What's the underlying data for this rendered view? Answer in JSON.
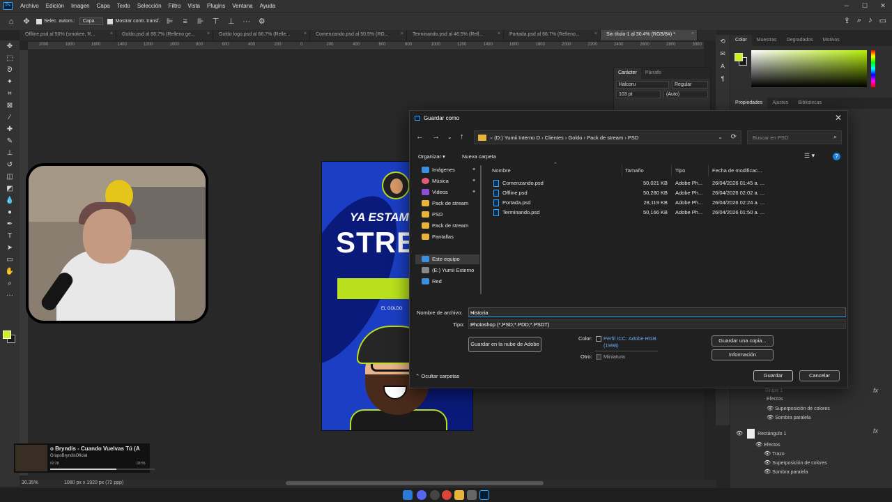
{
  "menubar": {
    "app_logo": "Ps",
    "items": [
      "Archivo",
      "Edición",
      "Imagen",
      "Capa",
      "Texto",
      "Selección",
      "Filtro",
      "Vista",
      "Plugins",
      "Ventana",
      "Ayuda"
    ]
  },
  "optbar": {
    "auto_select_label": "Selec. autom.:",
    "auto_select_target": "Capa",
    "show_transform_label": "Mostrar contr. transf."
  },
  "tabs": [
    {
      "label": "Offline.psd al 50% (smokee, R...",
      "active": false
    },
    {
      "label": "Goldo.psd al 66.7% (Relleno ge...",
      "active": false
    },
    {
      "label": "Goldo logo.psd al 66.7% (Relle...",
      "active": false
    },
    {
      "label": "Comenzando.psd al 50.5% (RG...",
      "active": false
    },
    {
      "label": "Terminando.psd al 46.5% (Rell...",
      "active": false
    },
    {
      "label": "Portada.psd al 66.7% (Relleno...",
      "active": false
    },
    {
      "label": "Sin título-1 al 30.4% (RGB/8#) *",
      "active": true
    }
  ],
  "ruler_labels": [
    "2000",
    "1800",
    "1600",
    "1400",
    "1200",
    "1000",
    "800",
    "600",
    "400",
    "200",
    "0",
    "200",
    "400",
    "600",
    "800",
    "1000",
    "1200",
    "1400",
    "1600",
    "1800",
    "2000",
    "2200",
    "2400",
    "2600",
    "2800",
    "3000"
  ],
  "document": {
    "line1": "YA ESTAM",
    "line2": "STRE",
    "tag": "EL GOLDO"
  },
  "mini_player": {
    "title": "o Bryndis - Cuando Vuelvas Tú (A",
    "artist": "GrupoBryndisOficial",
    "time_elapsed": "02:28",
    "time_total": "03:55",
    "progress": 0.63
  },
  "status_bar": {
    "zoom": "30.35%",
    "doc_info": "1080 px x 1920 px (72 ppp)"
  },
  "color_panel": {
    "tabs": [
      "Color",
      "Muestras",
      "Degradados",
      "Motivos"
    ],
    "foreground": "#cff01a",
    "background": "#1a1a1a"
  },
  "properties_panel": {
    "tabs": [
      "Propiedades",
      "Ajustes",
      "Bibliotecas"
    ]
  },
  "character_panel": {
    "tabs": [
      "Carácter",
      "Párrafo"
    ],
    "font_family": "Halcoru",
    "font_style": "Regular",
    "font_size": "103 pt",
    "leading": "(Auto)"
  },
  "layers": [
    {
      "label": "Grupo 1",
      "fx": true
    },
    {
      "label": "Efectos"
    },
    {
      "label": "Superposición de colores"
    },
    {
      "label": "Sombra paralela"
    },
    {
      "label": "Rectángulo 1",
      "fx": true
    },
    {
      "label": "Efectos"
    },
    {
      "label": "Trazo"
    },
    {
      "label": "Superposición de colores"
    },
    {
      "label": "Sombra paralela"
    }
  ],
  "dialog": {
    "title": "Guardar como",
    "address": {
      "segments": [
        "(D:) Yumii Interno D",
        "Clientes",
        "Goldo",
        "Pack de stream",
        "PSD"
      ]
    },
    "search_placeholder": "Buscar en PSD",
    "organize_label": "Organizar",
    "new_folder_label": "Nueva carpeta",
    "nav_items": [
      {
        "label": "Imágenes",
        "icon": "pictures-icon",
        "pinned": true,
        "color": "#3c8fdd"
      },
      {
        "label": "Música",
        "icon": "music-icon",
        "pinned": true,
        "color": "#e45a7a"
      },
      {
        "label": "Videos",
        "icon": "videos-icon",
        "pinned": true,
        "color": "#8a4fd6"
      },
      {
        "label": "Pack de stream",
        "icon": "folder-icon",
        "pinned": false,
        "color": "#e6b43a"
      },
      {
        "label": "PSD",
        "icon": "folder-icon",
        "pinned": false,
        "color": "#e6b43a"
      },
      {
        "label": "Pack de stream",
        "icon": "folder-icon",
        "pinned": false,
        "color": "#e6b43a"
      },
      {
        "label": "Pantallas",
        "icon": "folder-icon",
        "pinned": false,
        "color": "#e6b43a"
      },
      {
        "label": "Este equipo",
        "icon": "computer-icon",
        "pinned": false,
        "color": "#3c8fdd",
        "selected": true
      },
      {
        "label": "(E:) Yumii Externo",
        "icon": "drive-icon",
        "pinned": false,
        "color": "#888888"
      },
      {
        "label": "Red",
        "icon": "network-icon",
        "pinned": false,
        "color": "#3c8fdd"
      }
    ],
    "columns": [
      "Nombre",
      "Tamaño",
      "Tipo",
      "Fecha de modificac..."
    ],
    "files": [
      {
        "name": "Comenzando.psd",
        "size": "50,021 KB",
        "type": "Adobe Ph...",
        "date": "26/04/2026 01:45 a. ..."
      },
      {
        "name": "Offline.psd",
        "size": "50,280 KB",
        "type": "Adobe Ph...",
        "date": "26/04/2026 02:02 a. ..."
      },
      {
        "name": "Portada.psd",
        "size": "28,119 KB",
        "type": "Adobe Ph...",
        "date": "26/04/2026 02:24 a. ..."
      },
      {
        "name": "Terminando.psd",
        "size": "50,166 KB",
        "type": "Adobe Ph...",
        "date": "26/04/2026 01:50 a. ..."
      }
    ],
    "filename_label": "Nombre de archivo:",
    "filename_value": "Historia",
    "type_label": "Tipo:",
    "type_value": "Photoshop (*.PSD;*.PDD;*.PSDT)",
    "cloud_button": "Guardar en la nube de Adobe",
    "color_label": "Color:",
    "icc_profile": "Perfil ICC: Adobe RGB (1998)",
    "other_label": "Otro:",
    "thumbnail_label": "Miniatura",
    "save_copy_button": "Guardar una copia...",
    "info_button": "Información",
    "hide_folders_label": "Ocultar carpetas",
    "save_button": "Guardar",
    "cancel_button": "Cancelar"
  }
}
